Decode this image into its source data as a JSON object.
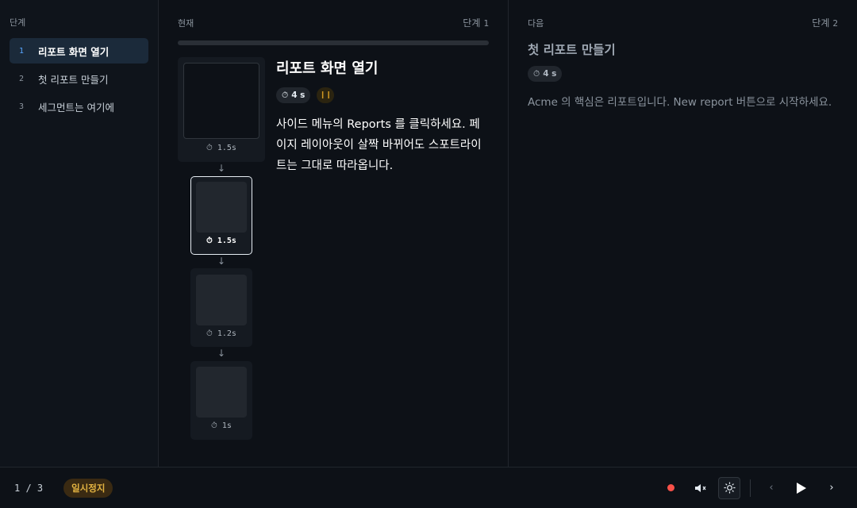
{
  "sidebar": {
    "title": "단계",
    "items": [
      {
        "num": "1",
        "label": "리포트 화면 열기",
        "active": true
      },
      {
        "num": "2",
        "label": "첫 리포트 만들기",
        "active": false
      },
      {
        "num": "3",
        "label": "세그먼트는 여기에",
        "active": false
      }
    ]
  },
  "current": {
    "label": "현재",
    "step_label": "단계",
    "step_num": "1",
    "progress": 0,
    "frames": [
      {
        "duration": "1.5s",
        "selected": false
      },
      {
        "duration": "1.5s",
        "selected": true
      },
      {
        "duration": "1.2s",
        "selected": false
      },
      {
        "duration": "1s",
        "selected": false
      }
    ],
    "timer_icon": "⏱",
    "arrow_icon": "↓",
    "title": "리포트 화면 열기",
    "time": "4 s",
    "description": "사이드 메뉴의 Reports 를 클릭하세요. 페이지 레이아웃이 살짝 바뀌어도 스포트라이트는 그대로 따라옵니다."
  },
  "next": {
    "label": "다음",
    "step_label": "단계",
    "step_num": "2",
    "title": "첫 리포트 만들기",
    "time": "4 s",
    "description": "Acme 의 핵심은 리포트입니다. New report 버튼으로 시작하세요."
  },
  "bottombar": {
    "counter": "1 / 3",
    "status": "일시정지",
    "icons": {
      "record": "record-icon",
      "mute": "mute-icon",
      "theme": "sun-icon",
      "prev": "chevron-left-icon",
      "play": "play-icon",
      "next": "chevron-right-icon"
    }
  },
  "colors": {
    "background": "#0d1117",
    "accent": "#58a6ff",
    "record": "#f85149",
    "paused": "#e3b341"
  }
}
